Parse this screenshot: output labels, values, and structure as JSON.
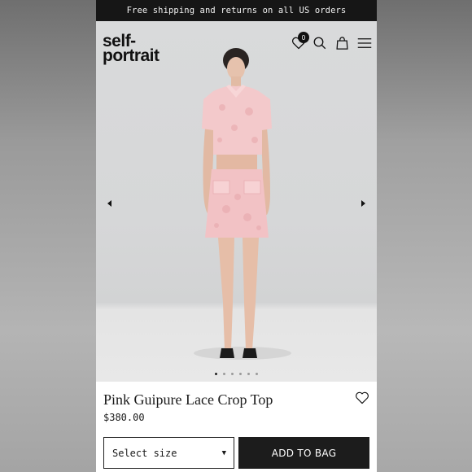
{
  "promo_bar": {
    "text": "Free shipping and returns on all US orders"
  },
  "header": {
    "logo_line1": "self-",
    "logo_line2": "portrait",
    "wishlist_count": "0",
    "icons": [
      "heart-icon",
      "search-icon",
      "bag-icon",
      "menu-icon"
    ]
  },
  "gallery": {
    "image": "model-wearing-pink-guipure-lace-set",
    "slide_count": 6,
    "active_slide": 1
  },
  "product": {
    "name": "Pink Guipure Lace Crop Top",
    "price": "$380.00",
    "size_select": "Select size",
    "add_to_bag": "ADD TO BAG"
  },
  "colors": {
    "black": "#161616",
    "pink": "#f2c4c7",
    "background": "#d8d9da"
  }
}
